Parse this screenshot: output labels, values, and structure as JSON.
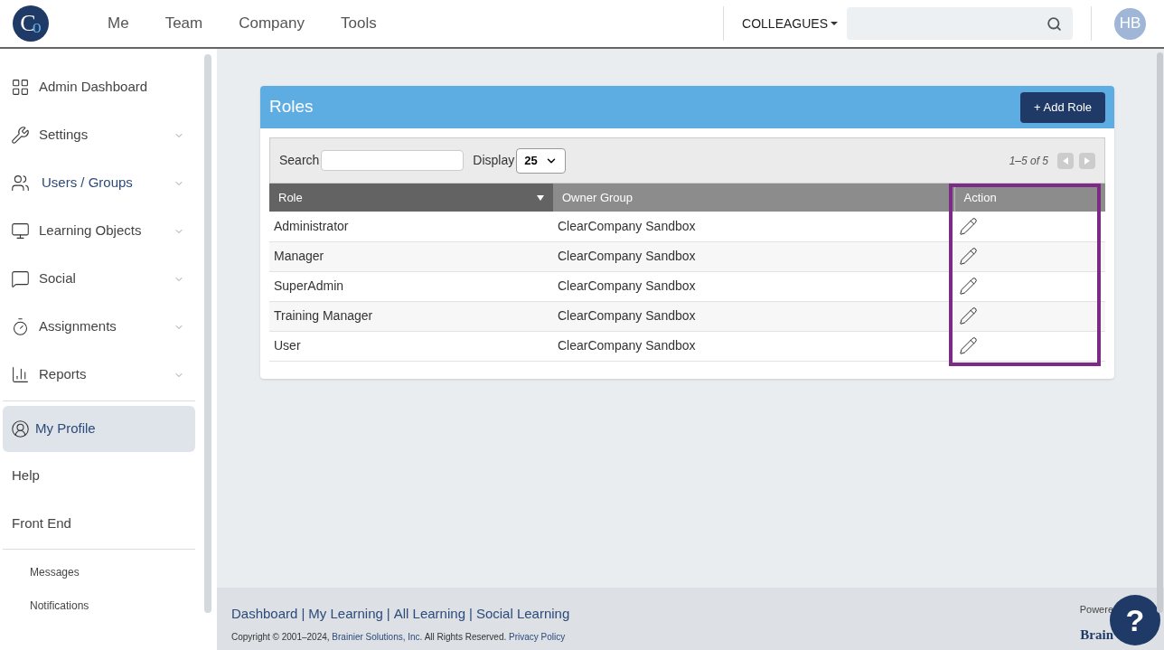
{
  "logo": {
    "first": "C",
    "second": "o"
  },
  "top_nav": [
    {
      "label": "Me"
    },
    {
      "label": "Team"
    },
    {
      "label": "Company"
    },
    {
      "label": "Tools"
    }
  ],
  "colleagues_menu": {
    "label": "COLLEAGUES"
  },
  "avatar": {
    "initials": "HB"
  },
  "sidebar": {
    "items": [
      {
        "label": "Admin Dashboard",
        "expandable": false,
        "selected": false,
        "highlighted": false
      },
      {
        "label": "Settings",
        "expandable": true,
        "selected": false,
        "highlighted": false
      },
      {
        "label": "Users / Groups",
        "expandable": true,
        "selected": false,
        "highlighted": true
      },
      {
        "label": "Learning Objects",
        "expandable": true,
        "selected": false,
        "highlighted": false
      },
      {
        "label": "Social",
        "expandable": true,
        "selected": false,
        "highlighted": false
      },
      {
        "label": "Assignments",
        "expandable": true,
        "selected": false,
        "highlighted": false
      },
      {
        "label": "Reports",
        "expandable": true,
        "selected": false,
        "highlighted": false
      }
    ],
    "profile": {
      "label": "My Profile",
      "selected": true
    },
    "links": [
      {
        "label": "Help"
      },
      {
        "label": "Front End"
      }
    ],
    "small_links": [
      {
        "label": "Messages"
      },
      {
        "label": "Notifications"
      }
    ]
  },
  "roles_panel": {
    "title": "Roles",
    "add_button": "+ Add Role",
    "search_label": "Search",
    "display_label": "Display",
    "display_value": "25",
    "pager_text": "1–5 of 5",
    "columns": [
      "Role",
      "Owner Group",
      "Action"
    ],
    "rows": [
      {
        "role": "Administrator",
        "owner_group": "ClearCompany Sandbox"
      },
      {
        "role": "Manager",
        "owner_group": "ClearCompany Sandbox"
      },
      {
        "role": "SuperAdmin",
        "owner_group": "ClearCompany Sandbox"
      },
      {
        "role": "Training Manager",
        "owner_group": "ClearCompany Sandbox"
      },
      {
        "role": "User",
        "owner_group": "ClearCompany Sandbox"
      }
    ]
  },
  "footer": {
    "links": [
      "Dashboard",
      "My Learning",
      "All Learning",
      "Social Learning"
    ],
    "separator": "|",
    "copyright_start": "Copyright © 2001–2024,",
    "company_link": "Brainier Solutions, Inc.",
    "copyright_end": "All Rights Reserved.",
    "privacy_link": "Privacy Policy",
    "powered_by": "Powere",
    "brand": "Brain"
  },
  "help_button": {
    "label": "?"
  }
}
